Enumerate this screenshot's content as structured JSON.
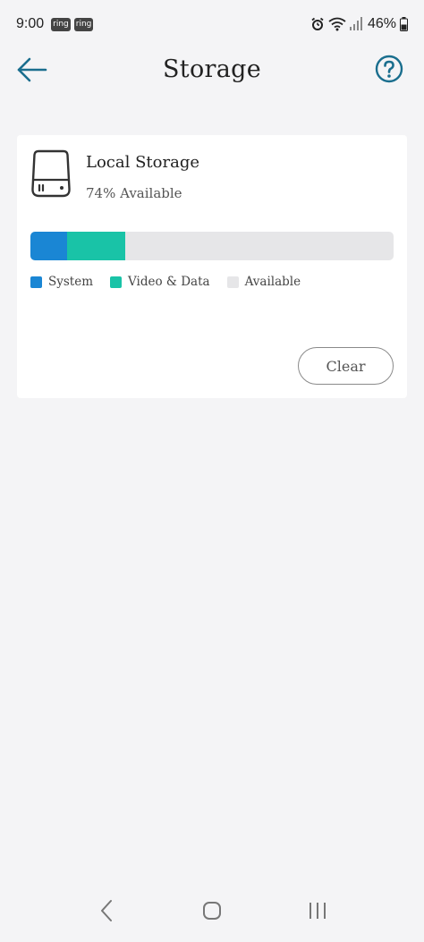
{
  "status_bar": {
    "time": "9:00",
    "badges": [
      "ring",
      "ring"
    ],
    "battery": "46%",
    "icons": [
      "alarm-icon",
      "wifi-icon",
      "signal-icon",
      "battery-icon"
    ]
  },
  "header": {
    "title": "Storage",
    "back_icon": "arrow-left-icon",
    "help_icon": "question-circle-icon"
  },
  "storage": {
    "icon": "hard-drive-icon",
    "title": "Local Storage",
    "available_text": "74% Available",
    "usage": {
      "system": 0.1,
      "video_data": 0.16,
      "available": 0.74
    },
    "legend": [
      {
        "label": "System",
        "color": "#1a86d4"
      },
      {
        "label": "Video & Data",
        "color": "#19c3a7"
      },
      {
        "label": "Available",
        "color": "#e6e6e8"
      }
    ],
    "clear_label": "Clear"
  },
  "nav_bar": {
    "icons": [
      "back-nav-icon",
      "home-nav-icon",
      "recents-nav-icon"
    ]
  },
  "colors": {
    "accent": "#1a6e8e",
    "background": "#f4f4f6",
    "card": "#ffffff"
  }
}
